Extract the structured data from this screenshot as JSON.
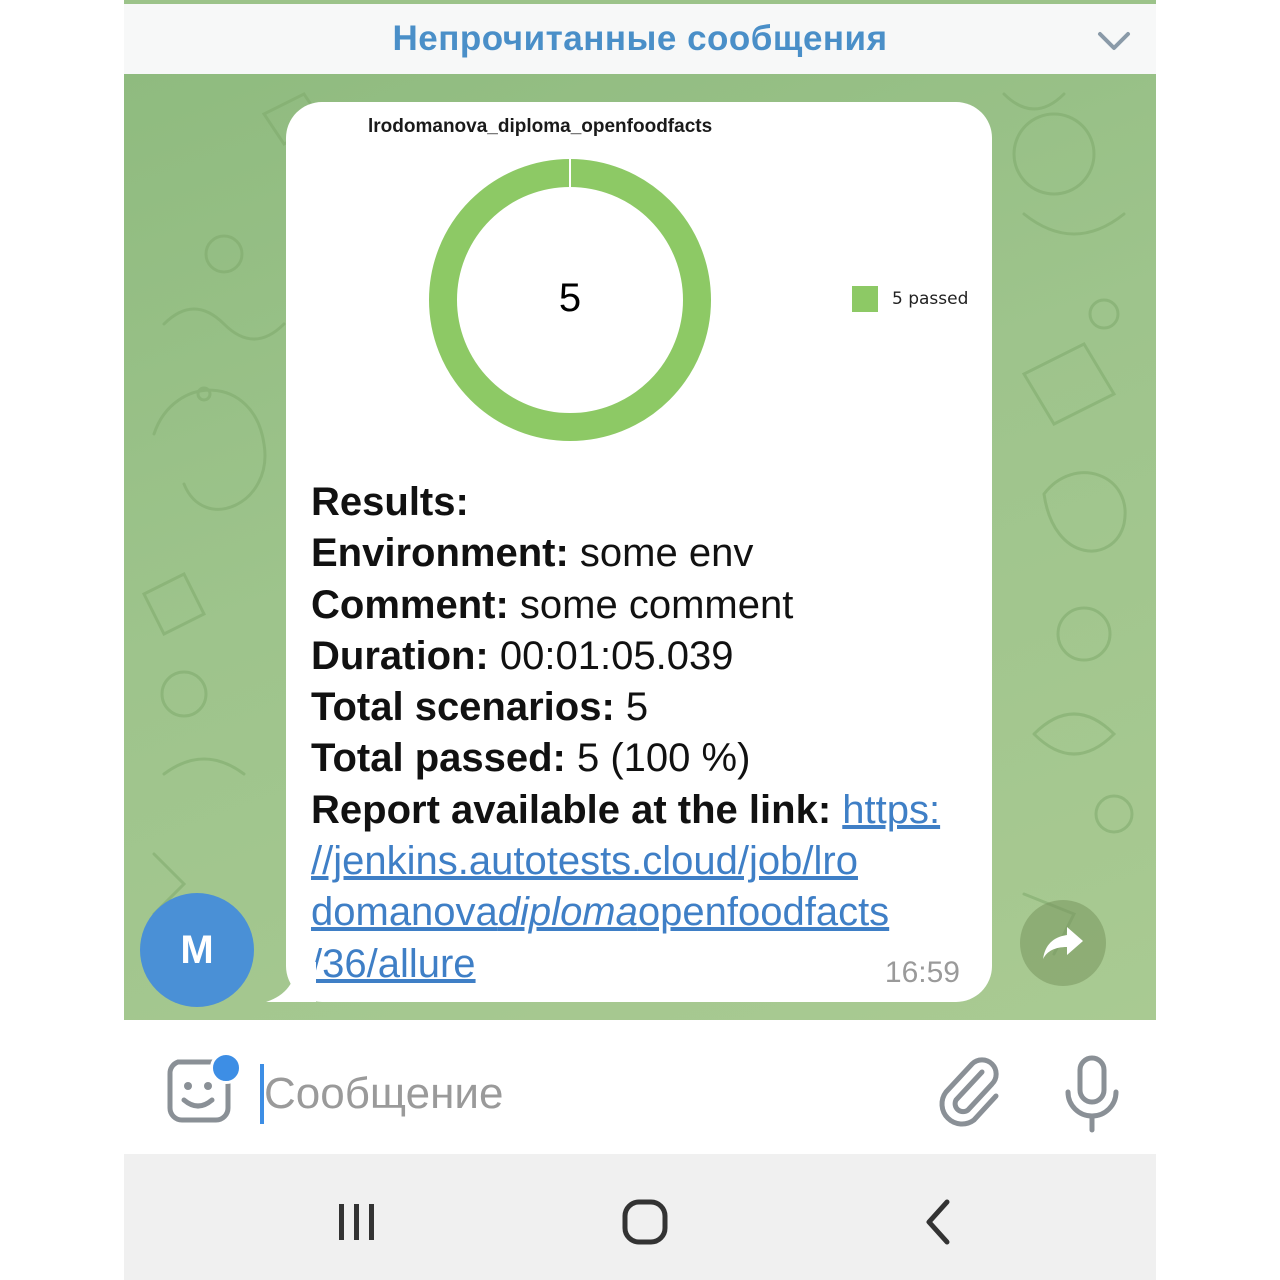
{
  "unread_bar": {
    "label": "Непрочитанные сообщения"
  },
  "report_chart": {
    "title": "lrodomanova_diploma_openfoodfacts",
    "total_label": "5",
    "legend_label": "5 passed",
    "colors": {
      "passed": "#8dc965"
    }
  },
  "chart_data": {
    "type": "pie",
    "title": "lrodomanova_diploma_openfoodfacts",
    "categories": [
      "passed"
    ],
    "values": [
      5
    ],
    "center_label": "5",
    "legend": [
      "5 passed"
    ]
  },
  "message": {
    "results_label": "Results:",
    "environment_label": "Environment:",
    "environment_value": " some env",
    "comment_label": "Comment:",
    "comment_value": " some comment",
    "duration_label": "Duration:",
    "duration_value": " 00:01:05.039",
    "scenarios_label": "Total scenarios:",
    "scenarios_value": " 5",
    "passed_label": "Total passed:",
    "passed_value": " 5 (100 %)",
    "report_label": "Report available at the link:",
    "report_link_line1": "https:",
    "report_link_line2": "//jenkins.autotests.cloud/job/lro",
    "report_link_line3_a": "domanova",
    "report_link_line3_b": "diploma",
    "report_link_line3_c": "openfoodfacts",
    "report_link_line4": "/36/allure",
    "time": "16:59"
  },
  "avatar": {
    "initial": "M",
    "color": "#4a90d6"
  },
  "composer": {
    "placeholder": "Сообщение",
    "value": ""
  },
  "icons": {
    "chevron": "chevron-down-icon",
    "forward": "forward-icon",
    "sticker": "sticker-icon",
    "attach": "paperclip-icon",
    "mic": "microphone-icon",
    "nav_recent": "recent-apps-icon",
    "nav_home": "home-icon",
    "nav_back": "back-icon"
  },
  "colors": {
    "accent": "#4a8fc8",
    "link": "#3f7fc6",
    "chat_bg": "#9ec48c"
  }
}
